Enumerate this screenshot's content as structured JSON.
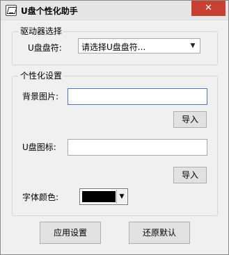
{
  "window": {
    "title": "U盘个性化助手",
    "close_glyph": "✕",
    "accent_close": "#c84031"
  },
  "drive_group": {
    "title": "驱动器选择",
    "drive_label": "U盘盘符:",
    "drive_select_value": "请选择U盘盘符...",
    "drive_select_arrow": "▼"
  },
  "personalize_group": {
    "title": "个性化设置",
    "background_label": "背景图片:",
    "background_value": "",
    "import_button_1": "导入",
    "icon_label": "U盘图标:",
    "icon_value": "",
    "import_button_2": "导入",
    "font_color_label": "字体颜色:",
    "font_color_value": "#000000",
    "font_color_arrow": "▼"
  },
  "actions": {
    "apply_button": "应用设置",
    "restore_button": "还原默认"
  }
}
